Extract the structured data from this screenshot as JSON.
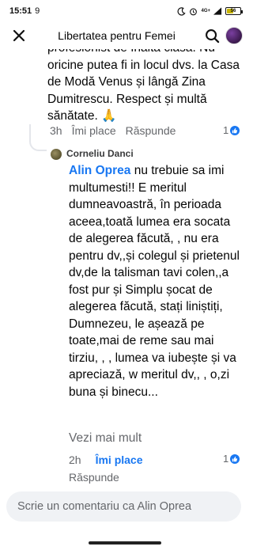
{
  "status_bar": {
    "time": "15:51",
    "location_glyph": "9",
    "network_label": "4G+",
    "battery_percent": 56,
    "battery_label": "56"
  },
  "header": {
    "title": "Libertatea pentru Femei"
  },
  "previous_comment": {
    "text": "profesionist de înaltă clasă. Nu oricine putea fi in locul dvs. la Casa de Modă Venus și lângă Zina Dumitrescu. Respect și multă sănătate. 🙏",
    "time": "3h",
    "like_label": "Îmi place",
    "reply_label": "Răspunde",
    "reaction_count": "1"
  },
  "reply": {
    "author": "Corneliu Danci",
    "mention": "Alin Oprea",
    "text": " nu trebuie sa imi multumesti!! E meritul dumneavoastră, în perioada aceea,toată lumea era socata de alegerea făcută, , nu era pentru dv,,și colegul și prietenul dv,de la talisman tavi colen,,a fost pur și Simplu șocat de alegerea făcută,  stați liniștiți, Dumnezeu, le așează pe toate,mai de reme sau mai tirziu,  , , lumea va iubește și va apreciază,  w meritul dv,, , o,zi buna și binecu...",
    "see_more_label": "Vezi mai mult",
    "time": "2h",
    "like_label": "Îmi place",
    "reply_label": "Răspunde",
    "reaction_count": "1"
  },
  "composer": {
    "placeholder": "Scrie un comentariu ca Alin Oprea"
  },
  "colors": {
    "accent": "#1877f2",
    "secondary_text": "#65676b",
    "composer_bg": "#f0f2f5"
  }
}
